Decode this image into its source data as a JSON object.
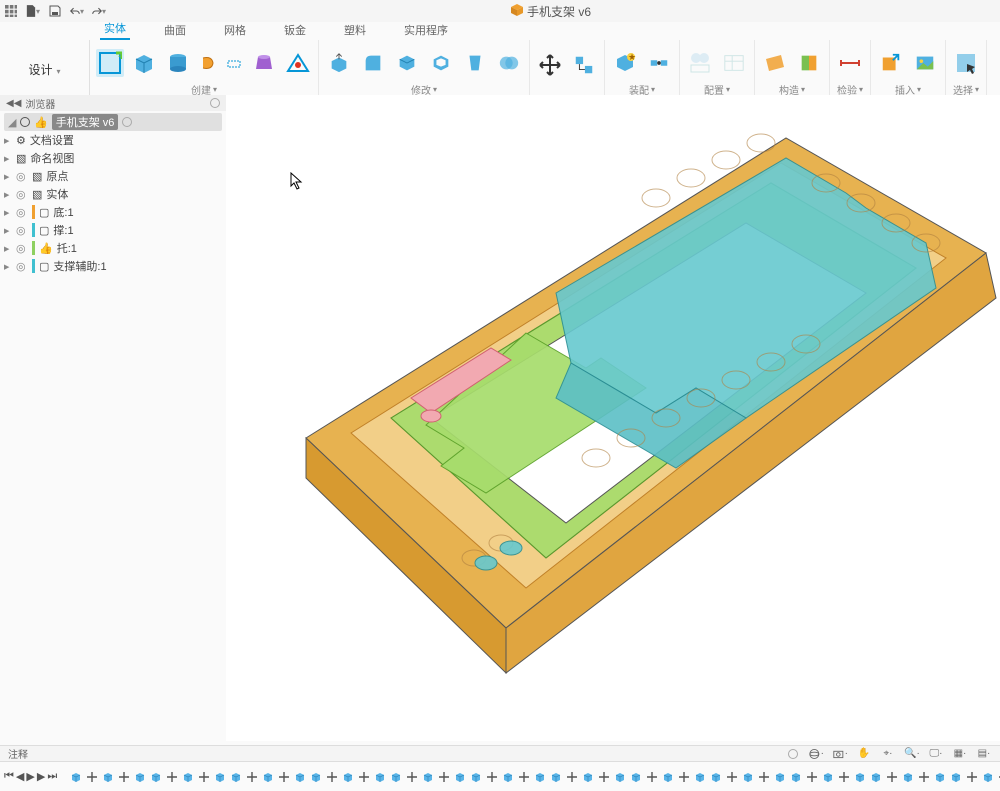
{
  "title": "手机支架 v6",
  "title_icon": "cube-orange-icon",
  "quick": {
    "grid": "grid-icon",
    "file": "file-icon",
    "save": "save-icon",
    "undo": "undo-icon",
    "redo": "redo-icon"
  },
  "design_button": "设计",
  "ribbon_tabs": [
    "实体",
    "曲面",
    "网格",
    "钣金",
    "塑料",
    "实用程序"
  ],
  "ribbon_active_tab": 0,
  "ribbon_groups": [
    {
      "label": "创建",
      "has_dropdown": true
    },
    {
      "label": "修改",
      "has_dropdown": true
    },
    {
      "label": "",
      "has_dropdown": false
    },
    {
      "label": "装配",
      "has_dropdown": true
    },
    {
      "label": "配置",
      "has_dropdown": true
    },
    {
      "label": "构造",
      "has_dropdown": true
    },
    {
      "label": "检验",
      "has_dropdown": true
    },
    {
      "label": "插入",
      "has_dropdown": true
    },
    {
      "label": "选择",
      "has_dropdown": true
    }
  ],
  "browser": {
    "header": "浏览器",
    "root": "手机支架 v6",
    "items": [
      {
        "label": "文档设置",
        "color": "",
        "icon": "gear-icon"
      },
      {
        "label": "命名视图",
        "color": "",
        "icon": "folder-icon"
      },
      {
        "label": "原点",
        "color": "",
        "icon": "folder-icon"
      },
      {
        "label": "实体",
        "color": "",
        "icon": "folder-icon"
      },
      {
        "label": "底:1",
        "color": "#f0a030",
        "icon": "cube-icon"
      },
      {
        "label": "撑:1",
        "color": "#40c0d0",
        "icon": "cube-icon"
      },
      {
        "label": "托:1",
        "color": "#8ed060",
        "icon": "cube-icon"
      },
      {
        "label": "支撑辅助:1",
        "color": "#40c0d0",
        "icon": "cube-icon"
      }
    ]
  },
  "comment_label": "注释",
  "view_tools": [
    "orbit-icon",
    "camera-icon",
    "hand-icon",
    "zoom-region-icon",
    "zoom-icon",
    "display-icon",
    "grid-display-icon",
    "layout-icon"
  ],
  "timeline_controls": [
    "skip-start-icon",
    "step-back-icon",
    "play-icon",
    "step-fwd-icon",
    "skip-end-icon"
  ],
  "timeline_count": 66,
  "colors": {
    "accent": "#0696d7",
    "base_orange": "#e6aa3c",
    "green": "#92d050",
    "teal": "#4fc1c7",
    "pink": "#f5a0a8"
  }
}
